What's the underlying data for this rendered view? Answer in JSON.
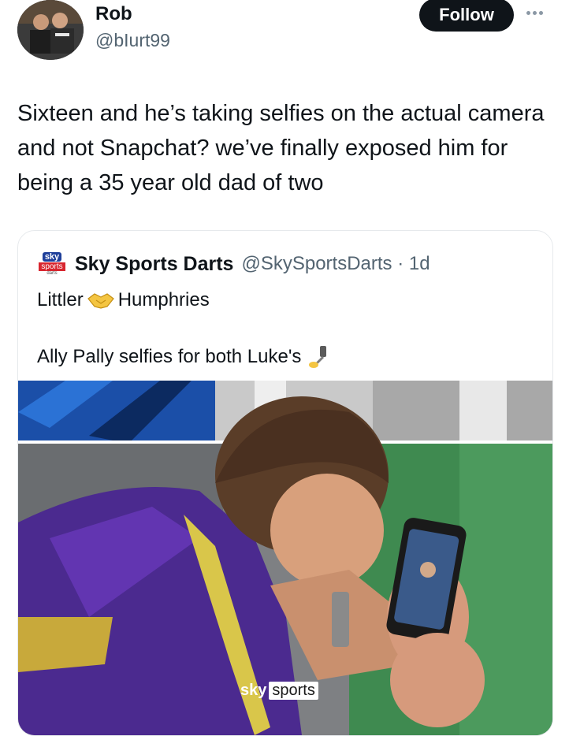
{
  "tweet": {
    "author_name": "Rob",
    "author_handle": "@bIurt99",
    "follow_label": "Follow",
    "text": "Sixteen and he’s taking selfies on the actual camera and not Snapchat? we’ve finally exposed him for being a 35 year old dad of two"
  },
  "quote": {
    "name": "Sky Sports Darts",
    "handle": "@SkySportsDarts · 1d",
    "line1_left": "Littler",
    "line1_right": "Humphries",
    "line2": "Ally Pally selfies for both Luke's",
    "logo": {
      "top": "sky",
      "middle": "sports",
      "bottom": "darts"
    },
    "watermark": {
      "left": "sky",
      "right": "sports"
    }
  },
  "icons": {
    "more": "more-horizontal-icon",
    "handshake": "handshake-emoji-icon",
    "selfie_stick": "selfie-stick-emoji-icon"
  },
  "colors": {
    "text": "#0f1419",
    "secondary": "#536471",
    "follow_bg": "#0f1419",
    "border": "#e6e9ec"
  }
}
